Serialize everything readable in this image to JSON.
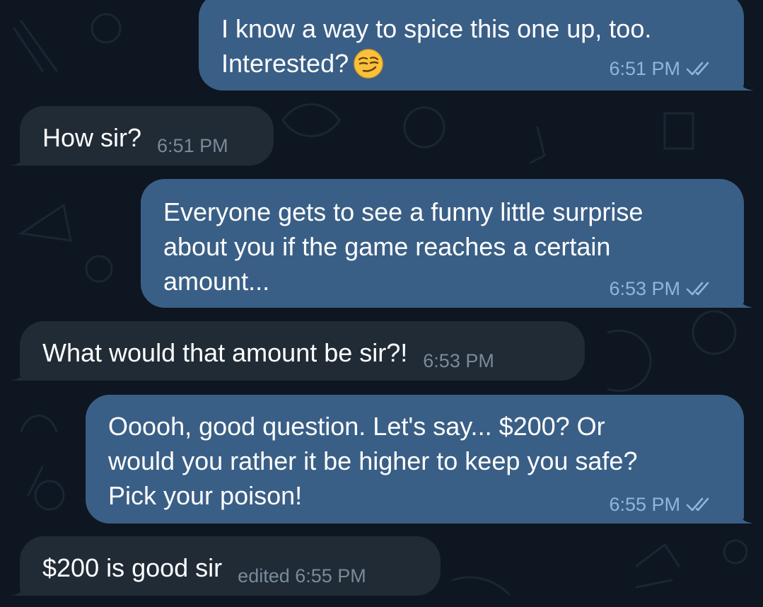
{
  "colors": {
    "background": "#0e1621",
    "outgoing_bubble": "#3a5f86",
    "incoming_bubble": "#202b36",
    "outgoing_meta": "#8fb6dd",
    "incoming_meta": "#7b8a99",
    "read_check": "#8fb6dd"
  },
  "messages": [
    {
      "direction": "out",
      "lines": [
        "I know a way to spice this one up, too.",
        "Interested?"
      ],
      "emoji": "smirking-face",
      "time": "6:51 PM",
      "status": "read"
    },
    {
      "direction": "in",
      "text": "How sir?",
      "time": "6:51 PM"
    },
    {
      "direction": "out",
      "lines": [
        "Everyone gets to see a funny little surprise",
        "about you if the game reaches a certain",
        "amount..."
      ],
      "time": "6:53 PM",
      "status": "read"
    },
    {
      "direction": "in",
      "text": "What would that amount be sir?!",
      "time": "6:53 PM"
    },
    {
      "direction": "out",
      "lines": [
        "Ooooh, good question. Let's say... $200? Or",
        "would you rather it be higher to keep you safe?",
        "Pick your poison!"
      ],
      "time": "6:55 PM",
      "status": "read"
    },
    {
      "direction": "in",
      "text": "$200 is good sir",
      "time": "edited 6:55 PM"
    }
  ]
}
